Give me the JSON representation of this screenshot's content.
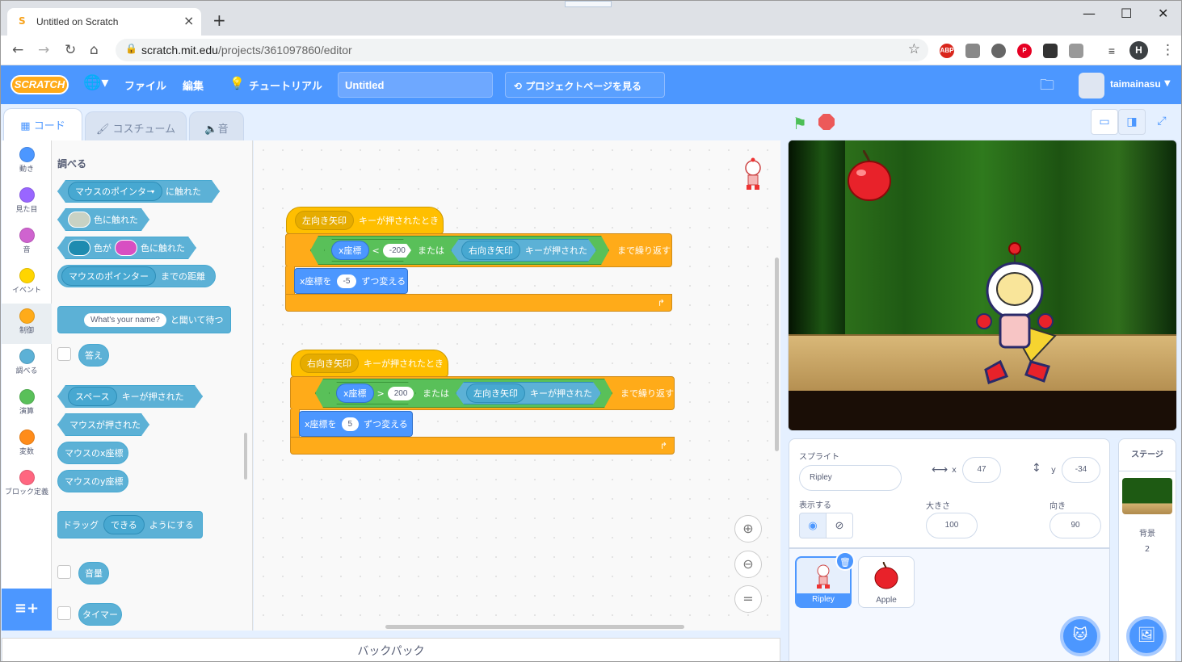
{
  "browser": {
    "tab_title": "Untitled on Scratch",
    "url_domain": "scratch.mit.edu",
    "url_path": "/projects/361097860/editor",
    "profile_initial": "H",
    "ext_abp": "ABP"
  },
  "menu": {
    "logo": "SCRATCH",
    "file": "ファイル",
    "edit": "編集",
    "tutorials": "チュートリアル",
    "project_title": "Untitled",
    "see_project": "プロジェクトページを見る",
    "username": "taimainasu"
  },
  "editor_tabs": {
    "code": "コード",
    "costumes": "コスチューム",
    "sounds": "音"
  },
  "categories": [
    {
      "label": "動き",
      "color": "#4c97ff"
    },
    {
      "label": "見た目",
      "color": "#9966ff"
    },
    {
      "label": "音",
      "color": "#cf63cf"
    },
    {
      "label": "イベント",
      "color": "#ffd500"
    },
    {
      "label": "制御",
      "color": "#ffab19"
    },
    {
      "label": "調べる",
      "color": "#5cb1d6"
    },
    {
      "label": "演算",
      "color": "#59c059"
    },
    {
      "label": "変数",
      "color": "#ff8c1a"
    },
    {
      "label": "ブロック定義",
      "color": "#ff6680"
    }
  ],
  "palette": {
    "heading": "調べる",
    "touching_dd": "マウスのポインター",
    "touching_suffix": "に触れた",
    "color_touching": "色に触れた",
    "color_is": "色が",
    "color_touching2": "色に触れた",
    "distance_dd": "マウスのポインター",
    "distance_suffix": "までの距離",
    "ask_default": "What's your name?",
    "ask_suffix": "と聞いて待つ",
    "answer": "答え",
    "key_dd": "スペース",
    "key_suffix": "キーが押された",
    "mouse_down": "マウスが押された",
    "mouse_x": "マウスのx座標",
    "mouse_y": "マウスのy座標",
    "drag_prefix": "ドラッグ",
    "drag_dd": "できる",
    "drag_suffix": "ようにする",
    "loudness": "音量",
    "timer": "タイマー"
  },
  "scripts": [
    {
      "hat_key": "左向き矢印",
      "hat_suffix": "キーが押されたとき",
      "cond_left": "x座標",
      "cond_op": "<",
      "cond_value": "-200",
      "or": "または",
      "key2": "右向き矢印",
      "key2_suffix": "キーが押された",
      "repeat_suffix": "まで繰り返す",
      "change_label": "x座標を",
      "change_value": "-5",
      "change_suffix": "ずつ変える"
    },
    {
      "hat_key": "右向き矢印",
      "hat_suffix": "キーが押されたとき",
      "cond_left": "x座標",
      "cond_op": ">",
      "cond_value": "200",
      "or": "または",
      "key2": "左向き矢印",
      "key2_suffix": "キーが押された",
      "repeat_suffix": "まで繰り返す",
      "change_label": "x座標を",
      "change_value": "5",
      "change_suffix": "ずつ変える"
    }
  ],
  "backpack": "バックパック",
  "sprite_info": {
    "sprite_label": "スプライト",
    "sprite_name": "Ripley",
    "x_label": "x",
    "x_value": "47",
    "y_label": "y",
    "y_value": "-34",
    "show_label": "表示する",
    "size_label": "大きさ",
    "size_value": "100",
    "direction_label": "向き",
    "direction_value": "90"
  },
  "sprites": [
    {
      "name": "Ripley",
      "selected": true
    },
    {
      "name": "Apple",
      "selected": false
    }
  ],
  "stage_panel": {
    "title": "ステージ",
    "backdrops_label": "背景",
    "backdrops_count": "2"
  }
}
